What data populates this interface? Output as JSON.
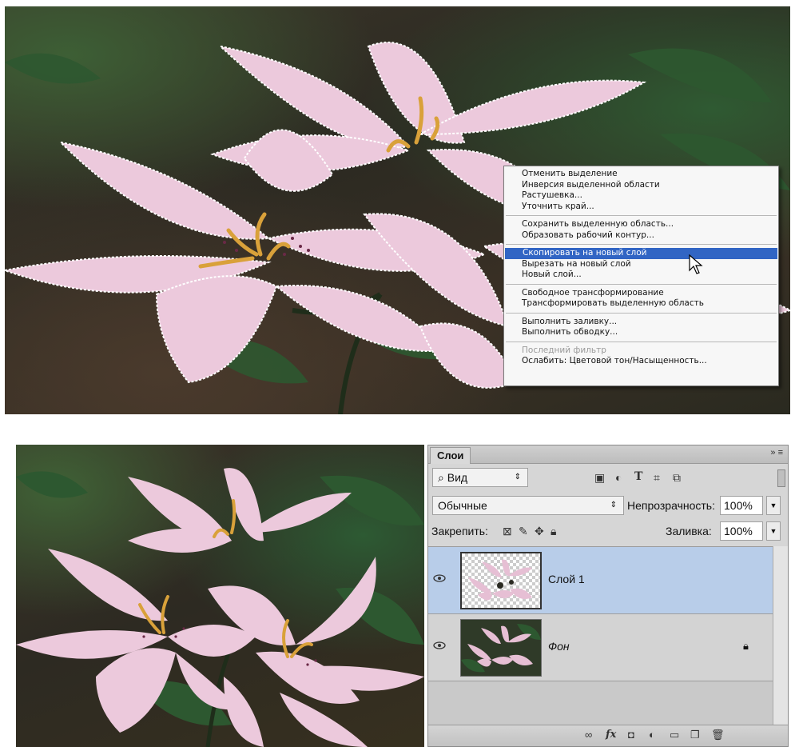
{
  "context_menu": {
    "items": [
      {
        "label": "Отменить выделение"
      },
      {
        "label": "Инверсия выделенной области"
      },
      {
        "label": "Растушевка..."
      },
      {
        "label": "Уточнить край..."
      },
      {
        "label": "Сохранить выделенную область..."
      },
      {
        "label": "Образовать рабочий контур..."
      },
      {
        "label": "Скопировать на новый слой"
      },
      {
        "label": "Вырезать на новый слой"
      },
      {
        "label": "Новый слой..."
      },
      {
        "label": "Свободное трансформирование"
      },
      {
        "label": "Трансформировать выделенную область"
      },
      {
        "label": "Выполнить заливку..."
      },
      {
        "label": "Выполнить обводку..."
      },
      {
        "label": "Последний фильтр"
      },
      {
        "label": "Ослабить: Цветовой тон/Насыщенность..."
      }
    ],
    "highlighted_item": "Скопировать на новый слой",
    "disabled_item": "Последний фильтр",
    "highlight_color": "#3165c4"
  },
  "layers_panel": {
    "tab_label": "Слои",
    "panel_menu_glyph": "»",
    "filter_kind": "Вид",
    "blend_mode": "Обычные",
    "opacity_label": "Непрозрачность:",
    "opacity_value": "100%",
    "lock_label": "Закрепить:",
    "fill_label": "Заливка:",
    "fill_value": "100%",
    "layers": [
      {
        "name": "Слой 1",
        "selected": true,
        "visible": true,
        "locked": false
      },
      {
        "name": "Фон",
        "selected": false,
        "visible": true,
        "locked": true
      }
    ],
    "selected_row_color": "#b8cde9",
    "filter_icons": [
      "image-filter-icon",
      "adjustment-filter-icon",
      "type-filter-icon",
      "shape-filter-icon",
      "smart-object-filter-icon"
    ],
    "lock_icons": [
      "lock-transparent-icon",
      "lock-image-icon",
      "lock-position-icon",
      "lock-all-icon"
    ],
    "footer_icons": [
      "link-layers-icon",
      "fx-icon",
      "add-mask-icon",
      "new-adjustment-icon",
      "new-group-icon",
      "new-layer-icon",
      "delete-layer-icon"
    ]
  },
  "colors": {
    "petal": "#e9c6d9",
    "stamen": "#d9a13a",
    "leaf": "#2f5a32"
  }
}
